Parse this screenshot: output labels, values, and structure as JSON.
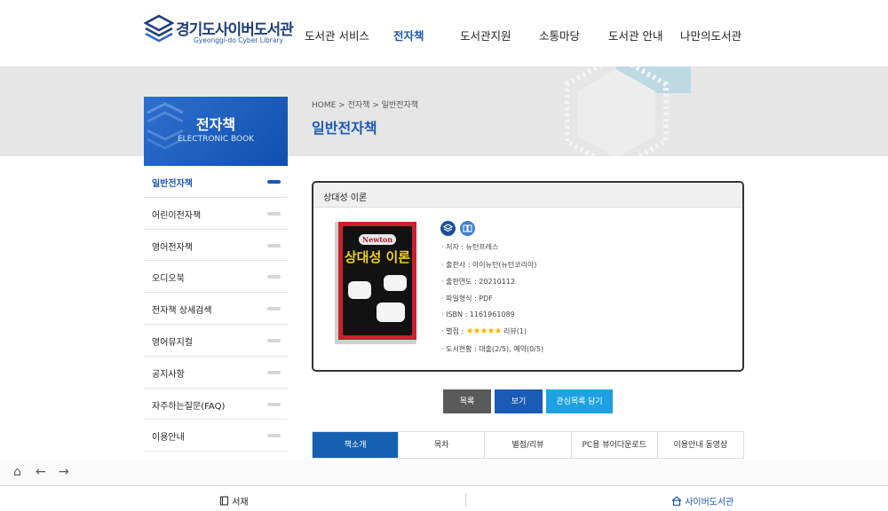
{
  "header": {
    "logo_ko": "경기도사이버도서관",
    "logo_en": "Gyeonggi-do Cyber Library",
    "nav": [
      "도서관 서비스",
      "전자책",
      "도서관지원",
      "소통마당",
      "도서관 안내",
      "나만의도서관"
    ],
    "active_nav": "전자책"
  },
  "lnb": {
    "title": "전자책",
    "subtitle": "ELECTRONIC BOOK",
    "items": [
      "일반전자책",
      "어린이전자책",
      "영어전자책",
      "오디오북",
      "전자책 상세검색",
      "영어뮤지컬",
      "공지사항",
      "자주하는질문(FAQ)",
      "이용안내"
    ],
    "active_index": 0
  },
  "content": {
    "breadcrumb": "HOME > 전자책 > 일반전자책",
    "page_title": "일반전자책"
  },
  "book": {
    "header_title": "상대성 이론",
    "cover_brand": "Newton",
    "cover_title": "상대성 이론",
    "author": "· 저자 : 뉴턴프레스",
    "publisher": "· 출판사 : 아이뉴턴(뉴턴코리아)",
    "year": "· 출판연도 : 20210112",
    "format": "· 파일형식 : PDF",
    "isbn": "· ISBN : 1161961089",
    "rating_label": "· 별점 :",
    "stars": "★★★★★",
    "rating_value": 5,
    "reviews": "리뷰(1)",
    "status": "· 도서현황 : 대출(2/5), 예약(0/5)",
    "badge_colors": [
      "#1d4f9a",
      "#3f7ed3"
    ]
  },
  "buttons": {
    "list": "목록",
    "view": "보기",
    "wishlist": "관심목록 담기"
  },
  "tabs": {
    "items": [
      "책소개",
      "목차",
      "별점/리뷰",
      "PC용 뷰어다운로드",
      "이용안내 동영상"
    ],
    "active_index": 0
  },
  "bottom_bar": {
    "bookshelf": "서재",
    "library": "사이버도서관"
  },
  "colors": {
    "primary": "#1b58b3",
    "tab_active": "#1560b0",
    "btn_list": "#5a5a5a",
    "btn_view": "#1a5bb5",
    "btn_wish": "#1da1e0"
  }
}
